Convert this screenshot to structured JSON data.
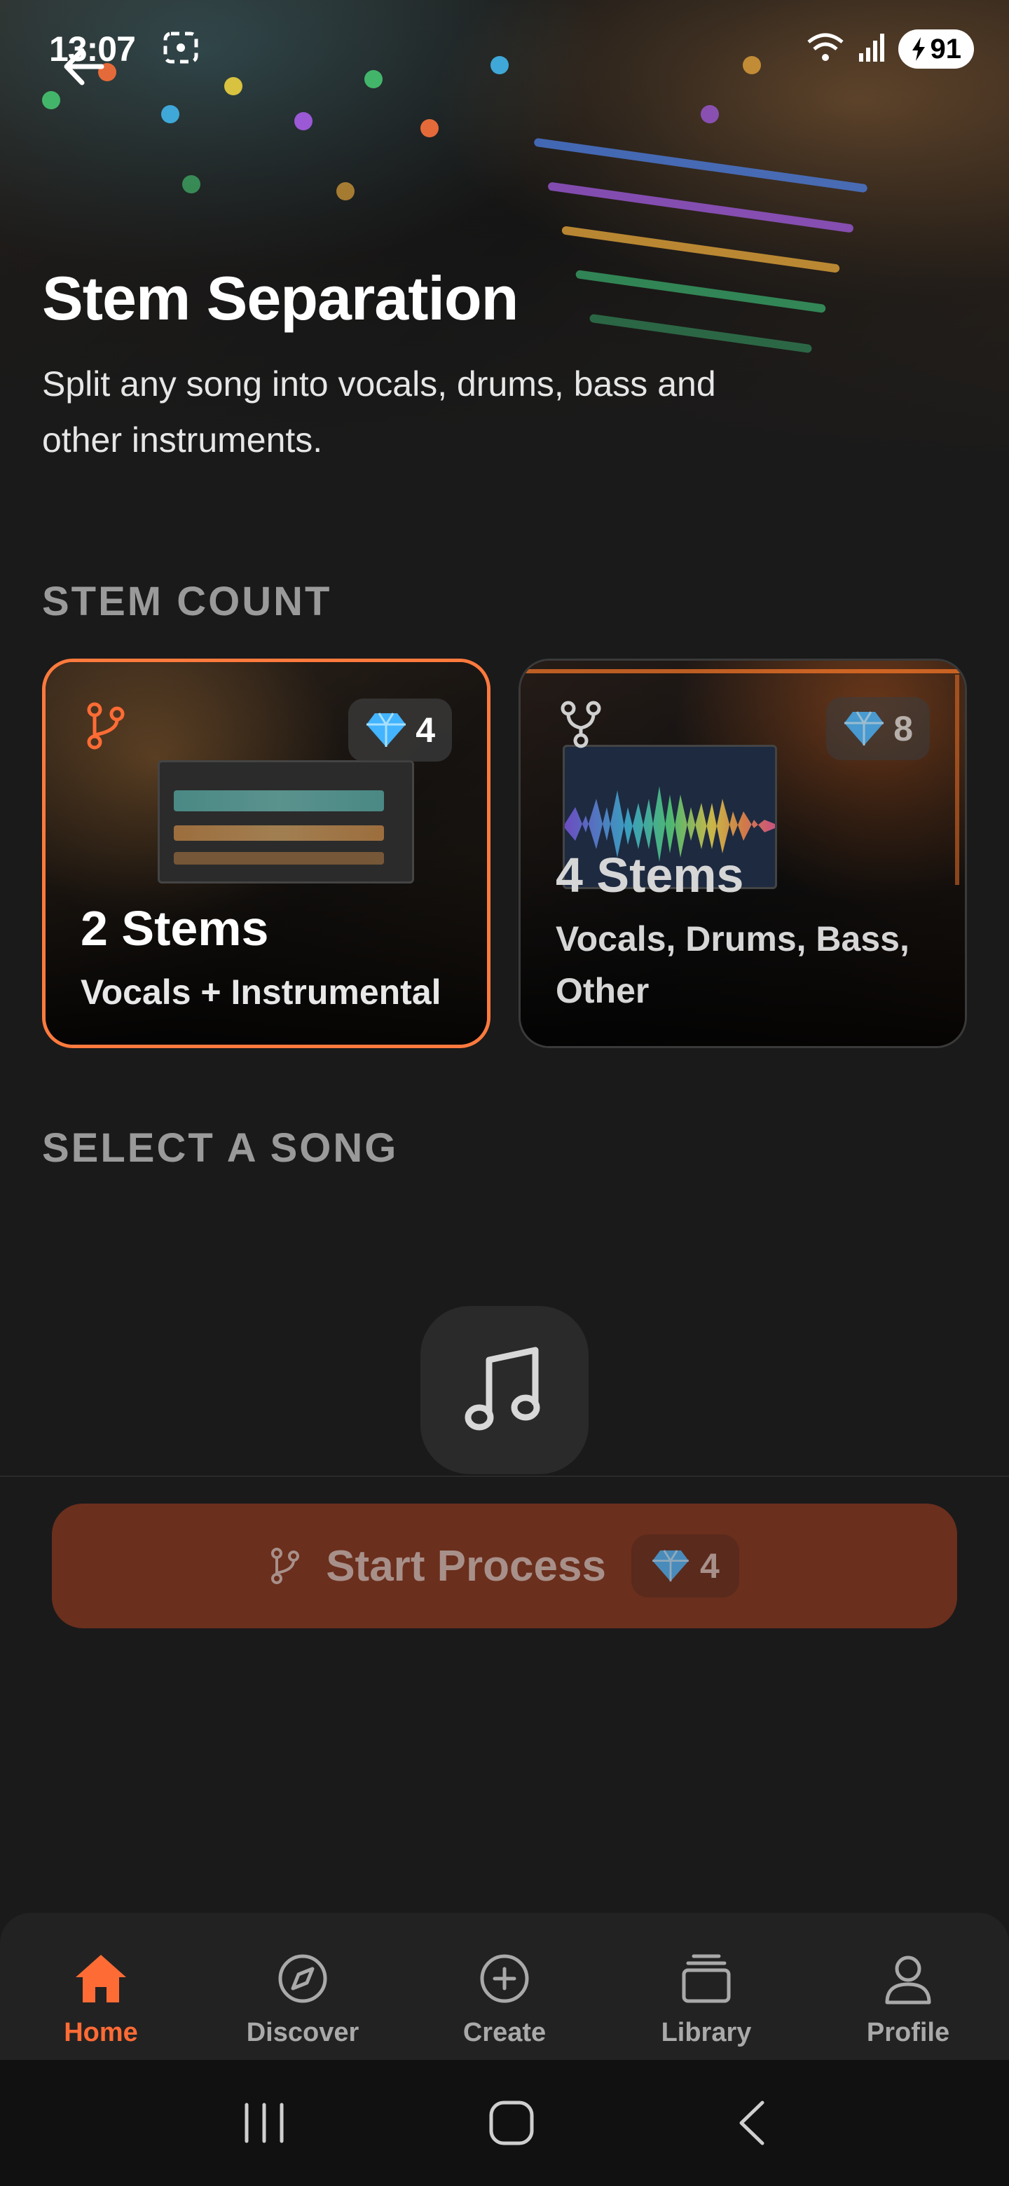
{
  "status_bar": {
    "time": "13:07",
    "battery": "91"
  },
  "header": {
    "title": "Stem Separation",
    "subtitle": "Split any song into vocals, drums, bass and other instruments."
  },
  "stem_count": {
    "label": "STEM COUNT",
    "options": [
      {
        "title": "2 Stems",
        "description": "Vocals + Instrumental",
        "cost": "4",
        "selected": true
      },
      {
        "title": "4 Stems",
        "description": "Vocals, Drums, Bass, Other",
        "cost": "8",
        "selected": false
      }
    ]
  },
  "song_section": {
    "label": "SELECT A SONG",
    "icon": "music-note-icon"
  },
  "action": {
    "label": "Start Process",
    "cost": "4"
  },
  "colors": {
    "accent": "#ff6b35",
    "button_bg": "#6b2f1d",
    "background": "#1a1a1a"
  },
  "nav": {
    "items": [
      {
        "label": "Home",
        "icon": "home-icon",
        "active": true
      },
      {
        "label": "Discover",
        "icon": "compass-icon",
        "active": false
      },
      {
        "label": "Create",
        "icon": "plus-circle-icon",
        "active": false
      },
      {
        "label": "Library",
        "icon": "library-icon",
        "active": false
      },
      {
        "label": "Profile",
        "icon": "profile-icon",
        "active": false
      }
    ]
  }
}
